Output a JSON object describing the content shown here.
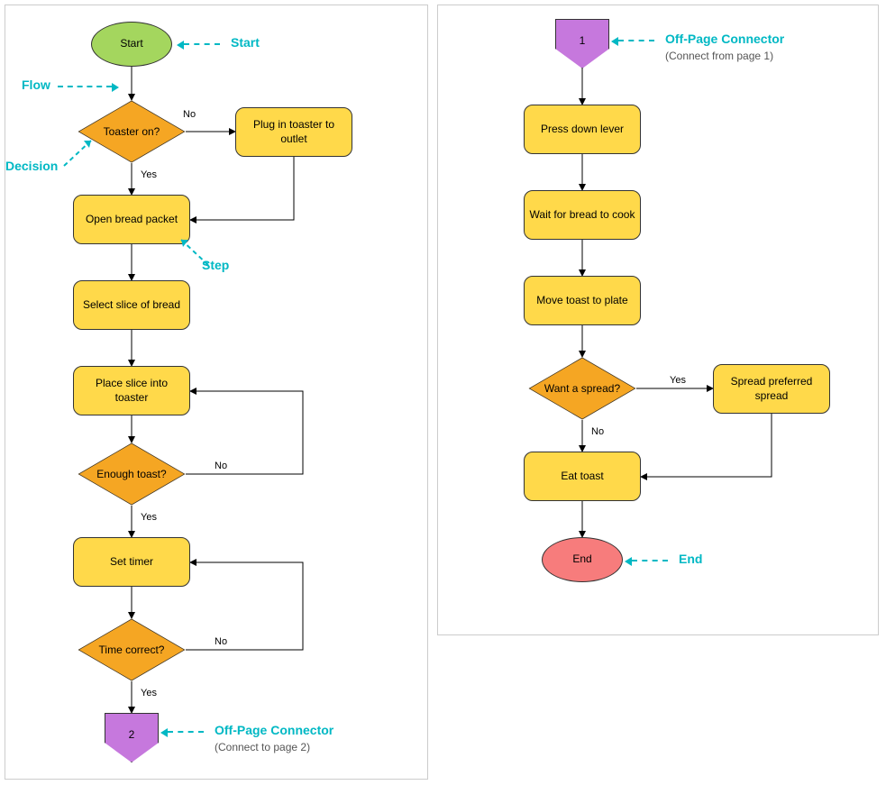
{
  "color": {
    "start": "#a4d65e",
    "process": "#ffd94a",
    "decision": "#f5a623",
    "offpage": "#c678dd",
    "end": "#f77c7c",
    "annotation": "#00b8c4"
  },
  "page1": {
    "start": "Start",
    "d_toaster": "Toaster on?",
    "d_toaster_yes": "Yes",
    "d_toaster_no": "No",
    "plug": "Plug in toaster to outlet",
    "open_packet": "Open bread packet",
    "select_slice": "Select slice of bread",
    "place_slice": "Place slice into toaster",
    "d_enough": "Enough toast?",
    "d_enough_yes": "Yes",
    "d_enough_no": "No",
    "set_timer": "Set timer",
    "d_time": "Time correct?",
    "d_time_yes": "Yes",
    "d_time_no": "No",
    "offpage": "2"
  },
  "page2": {
    "offpage": "1",
    "press_lever": "Press down lever",
    "wait_cook": "Wait for bread to cook",
    "move_plate": "Move toast to plate",
    "d_spread": "Want a spread?",
    "d_spread_yes": "Yes",
    "d_spread_no": "No",
    "spread": "Spread preferred spread",
    "eat": "Eat toast",
    "end": "End"
  },
  "annotations": {
    "start": "Start",
    "flow": "Flow",
    "decision": "Decision",
    "step": "Step",
    "offpage": "Off-Page Connector",
    "offpage1_sub": "(Connect to page 2)",
    "offpage2_sub": "(Connect from page 1)",
    "end": "End"
  }
}
